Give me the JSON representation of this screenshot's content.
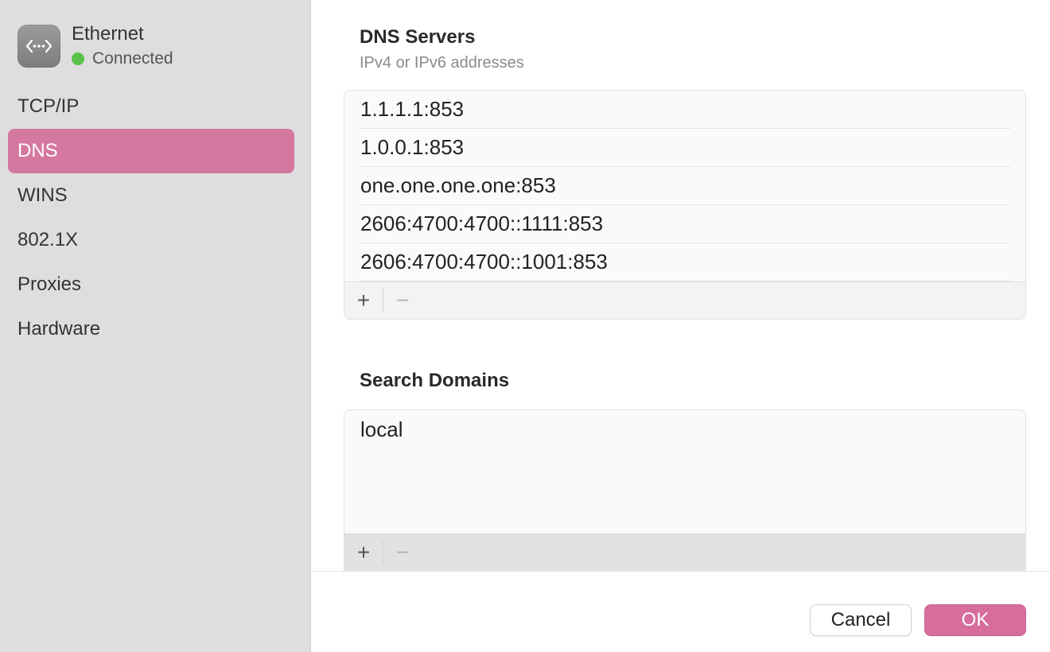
{
  "interface": {
    "name": "Ethernet",
    "status": "Connected",
    "icon": "ethernet-arrows-icon",
    "status_color": "#5ac14a"
  },
  "sidebar": {
    "items": [
      {
        "label": "TCP/IP",
        "active": false
      },
      {
        "label": "DNS",
        "active": true
      },
      {
        "label": "WINS",
        "active": false
      },
      {
        "label": "802.1X",
        "active": false
      },
      {
        "label": "Proxies",
        "active": false
      },
      {
        "label": "Hardware",
        "active": false
      }
    ]
  },
  "dns_servers": {
    "title": "DNS Servers",
    "subtitle": "IPv4 or IPv6 addresses",
    "entries": [
      "1.1.1.1:853",
      "1.0.0.1:853",
      "one.one.one.one:853",
      "2606:4700:4700::1111:853",
      "2606:4700:4700::1001:853"
    ],
    "add_label": "+",
    "remove_label": "−"
  },
  "search_domains": {
    "title": "Search Domains",
    "entries": [
      "local"
    ],
    "add_label": "+",
    "remove_label": "−"
  },
  "footer": {
    "cancel_label": "Cancel",
    "ok_label": "OK"
  },
  "colors": {
    "accent": "#d4789f",
    "ok_button": "#d66d9d",
    "sidebar_bg": "#dedede"
  }
}
